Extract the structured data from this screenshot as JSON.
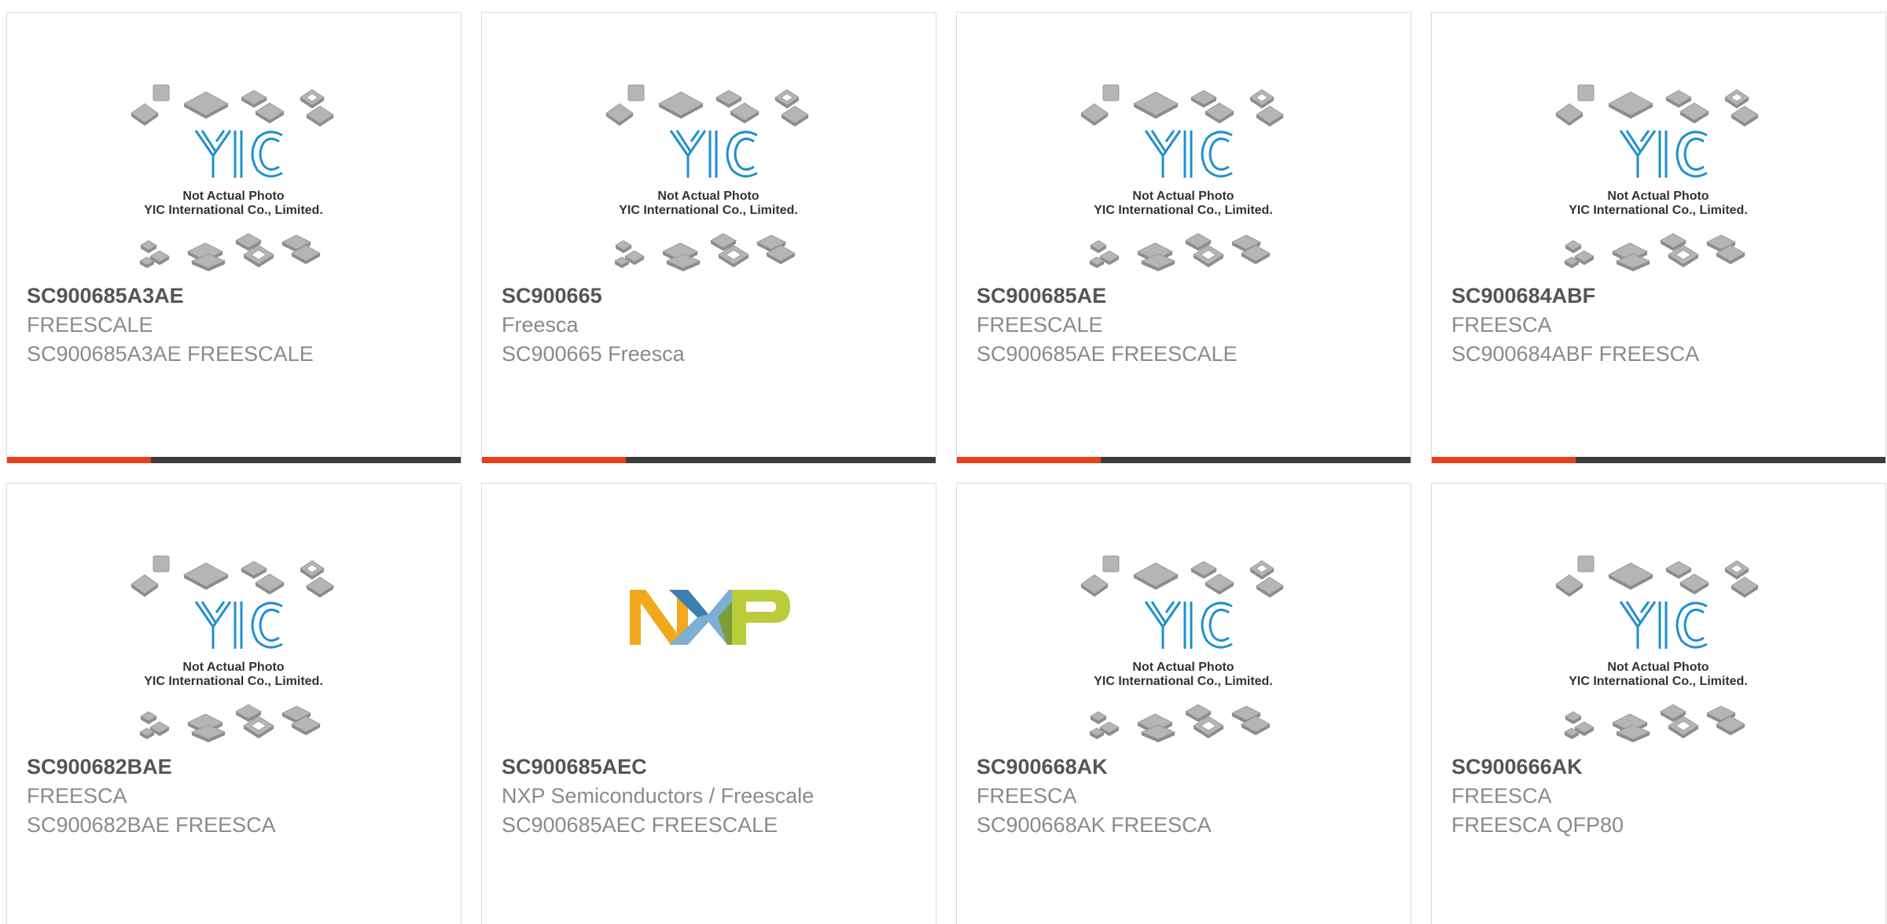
{
  "theme": {
    "accent": "#e8401c",
    "bar_dark": "#3d3d3d",
    "logo_blue": "#1f8fcf",
    "chip_grey": "#b5b5b5"
  },
  "placeholder": {
    "line1": "Not Actual Photo",
    "line2": "YIC International Co., Limited.",
    "logo_text": "YIC"
  },
  "products": [
    {
      "part": "SC900685A3AE",
      "brand": "FREESCALE",
      "desc": "SC900685A3AE FREESCALE",
      "image": "yic-placeholder"
    },
    {
      "part": "SC900665",
      "brand": "Freesca",
      "desc": "SC900665 Freesca",
      "image": "yic-placeholder"
    },
    {
      "part": "SC900685AE",
      "brand": "FREESCALE",
      "desc": "SC900685AE FREESCALE",
      "image": "yic-placeholder"
    },
    {
      "part": "SC900684ABF",
      "brand": "FREESCA",
      "desc": "SC900684ABF FREESCA",
      "image": "yic-placeholder"
    },
    {
      "part": "SC900682BAE",
      "brand": "FREESCA",
      "desc": "SC900682BAE FREESCA",
      "image": "yic-placeholder"
    },
    {
      "part": "SC900685AEC",
      "brand": "NXP Semiconductors / Freescale",
      "desc": "SC900685AEC FREESCALE",
      "image": "nxp-logo"
    },
    {
      "part": "SC900668AK",
      "brand": "FREESCA",
      "desc": "SC900668AK FREESCA",
      "image": "yic-placeholder"
    },
    {
      "part": "SC900666AK",
      "brand": "FREESCA",
      "desc": "FREESCA QFP80",
      "image": "yic-placeholder"
    }
  ]
}
